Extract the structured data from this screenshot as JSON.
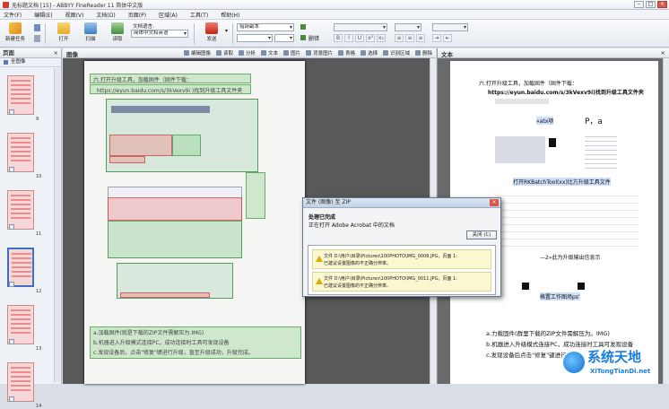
{
  "window": {
    "title": "无标题文档 [15] - ABBYY FineReader 11 简体中文版",
    "min": "–",
    "max": "□",
    "close": "×"
  },
  "menu": [
    "文件(F)",
    "编辑(E)",
    "视图(V)",
    "文档(D)",
    "页面(P)",
    "区域(A)",
    "工具(T)",
    "帮助(H)"
  ],
  "toolbar": {
    "new_task": "新建任务",
    "open": "打开",
    "scan": "扫描",
    "read": "读取",
    "send": "发送",
    "doc_lang_label": "文档语言:",
    "doc_lang_value": "简体中文和英语",
    "style_value": "措辞副本",
    "bookmarks_label": "删错",
    "font_btns": [
      "B",
      "I",
      "U",
      "x²",
      "x₂"
    ]
  },
  "pages_panel": {
    "title": "页面",
    "close": "×",
    "select_all": "全图像",
    "thumb_numbers": [
      "9",
      "10",
      "11",
      "12",
      "13",
      "14"
    ]
  },
  "image_panel": {
    "title": "图像",
    "tools": [
      "编辑图像",
      "读取",
      "分析",
      "文本",
      "图片",
      "背景图片",
      "表格",
      "选择",
      "识别区域",
      "删除"
    ]
  },
  "image_page": {
    "line1": "六.打开升级工具，加载固件（固件下载：",
    "line2": "https://eyun.baidu.com/s/3kVexv9i )找到升级工具文件夹",
    "bottom1": "a.加载固件(就是下载的ZIP文件需解压为.IMG)",
    "bottom2": "b.机器进入升级模式连接PC，成功连接时工具可发现设备",
    "bottom3": "c.发现设备后，点击\"修复\"键进行升级，直至升级成功，升级完成。"
  },
  "text_panel": {
    "title": "文本",
    "close": "×"
  },
  "text_page": {
    "l1": "六.打开升级工具，加载固件（固件下载：",
    "l2": "https://eyun.baidu.com/s/3kVexv9i)找到升级工具文件夹",
    "l3": "«atx项",
    "l4": "P，a",
    "l5": "打开RKBatchTool(xx)比方升级工具文件",
    "l6": "—2»此为升级输出信息示",
    "l7": "格置工作图场ps'",
    "l8": "a.力载固件(群里下载的ZIP文件需解压为。IMG)",
    "l9": "b.机器进入升级模式连接PC，成功连接时工具可发现设备",
    "l10": "c.发现设备后点击\"修复\"键进行升级"
  },
  "dialog": {
    "title": "文件 (图像) 至 ZIP",
    "status": "处理已完成",
    "sub": "正在打开 Adobe Acrobat 中的文档",
    "close_btn": "关闭 (C)",
    "warn1_a": "文件 D:\\用户\\目录\\Pictures\\100PHOTO\\IMG_0008.JPG，页面 1:",
    "warn1_b": "已建议设置图像的不正确分辨率。",
    "warn2_a": "文件 D:\\用户\\目录\\Pictures\\100PHOTO\\IMG_0011.JPG，页面 1:",
    "warn2_b": "已建议设置图像的不正确分辨率。"
  },
  "watermark": {
    "name": "系统天地",
    "url": "XiTongTianDi.net"
  }
}
